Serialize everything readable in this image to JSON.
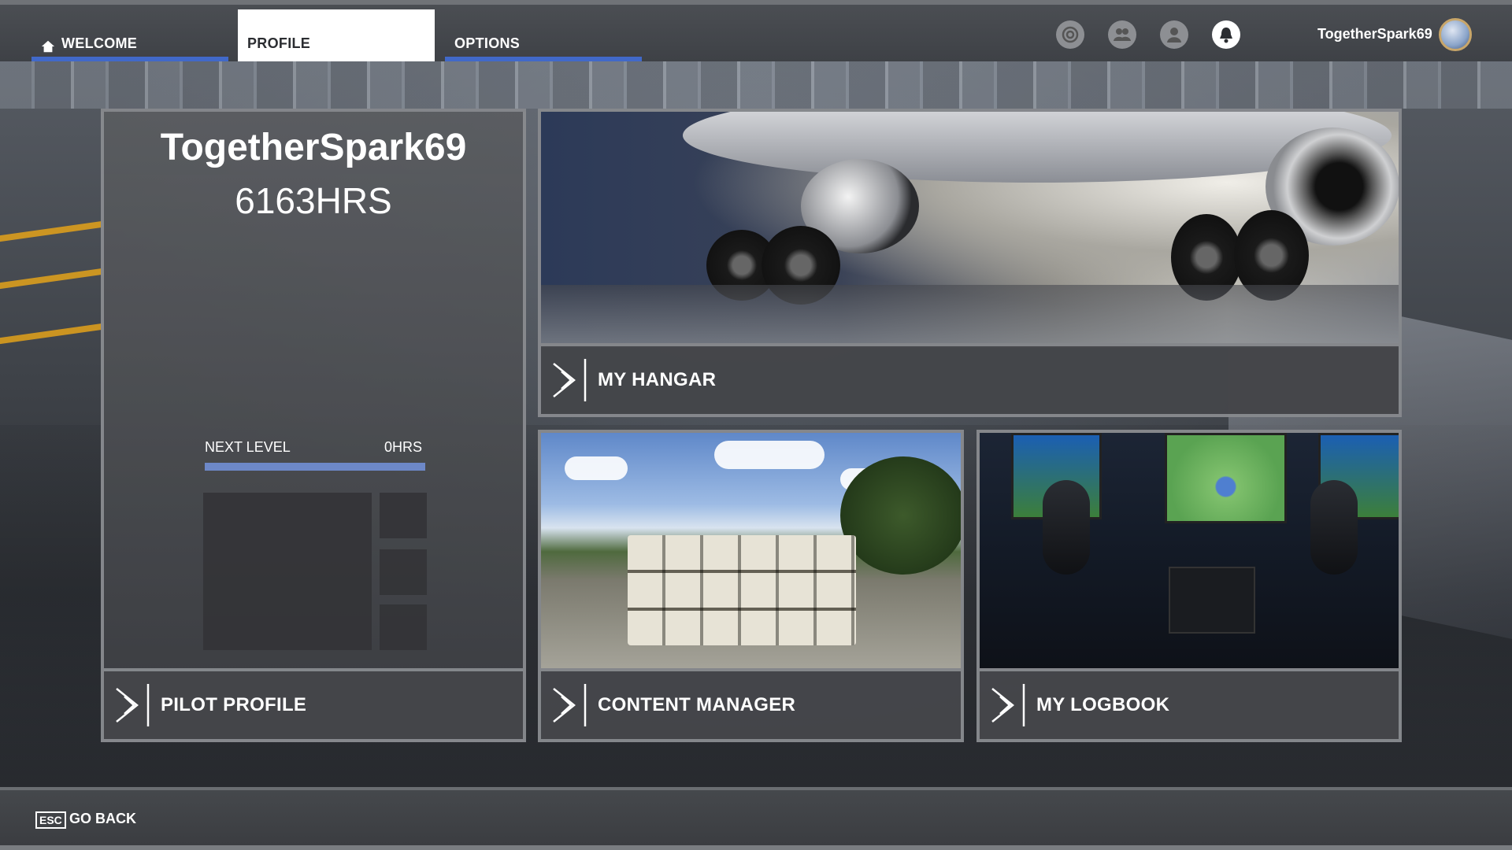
{
  "topbar": {
    "tabs": [
      {
        "label": "WELCOME",
        "icon": "home-icon",
        "active": false
      },
      {
        "label": "PROFILE",
        "active": true
      },
      {
        "label": "OPTIONS",
        "active": false
      }
    ],
    "icons": [
      "achievements-icon",
      "friends-icon",
      "user-icon",
      "notifications-icon"
    ],
    "username": "TogetherSpark69"
  },
  "pilot": {
    "name": "TogetherSpark69",
    "hours": "6163HRS",
    "next_level_label": "NEXT LEVEL",
    "next_level_hours": "0HRS",
    "next_level_progress": 1.0,
    "action_label": "PILOT PROFILE"
  },
  "tiles": {
    "hangar": "MY HANGAR",
    "content": "CONTENT MANAGER",
    "logbook": "MY LOGBOOK"
  },
  "footer": {
    "key": "ESC",
    "back_label": "GO BACK"
  },
  "colors": {
    "accent": "#4169c9",
    "panel": "#484a4e",
    "border": "#8c8e92"
  }
}
